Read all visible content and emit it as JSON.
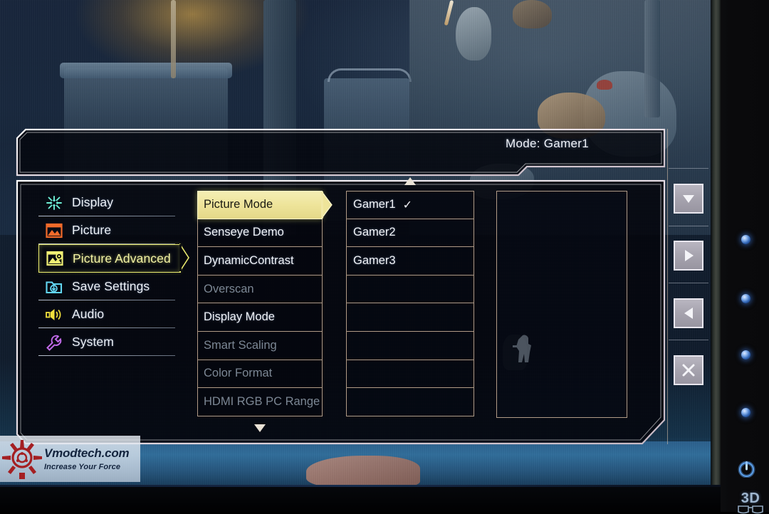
{
  "osd": {
    "title": "Mode: Gamer1",
    "sidebar": [
      {
        "label": "Display",
        "icon": "display-icon",
        "active": false
      },
      {
        "label": "Picture",
        "icon": "picture-icon",
        "active": false
      },
      {
        "label": "Picture Advanced",
        "icon": "picture-advanced-icon",
        "active": true
      },
      {
        "label": "Save Settings",
        "icon": "save-settings-icon",
        "active": false
      },
      {
        "label": "Audio",
        "icon": "audio-icon",
        "active": false
      },
      {
        "label": "System",
        "icon": "system-icon",
        "active": false
      }
    ],
    "settings_column": [
      {
        "label": "Picture Mode",
        "state": "selected"
      },
      {
        "label": "Senseye Demo",
        "state": "normal"
      },
      {
        "label": "DynamicContrast",
        "state": "normal"
      },
      {
        "label": "Overscan",
        "state": "disabled"
      },
      {
        "label": "Display Mode",
        "state": "normal"
      },
      {
        "label": "Smart Scaling",
        "state": "disabled"
      },
      {
        "label": "Color Format",
        "state": "disabled"
      },
      {
        "label": "HDMI RGB PC Range",
        "state": "disabled"
      }
    ],
    "values_column": [
      {
        "label": "Gamer1",
        "checked": true
      },
      {
        "label": "Gamer2",
        "checked": false
      },
      {
        "label": "Gamer3",
        "checked": false
      },
      {
        "label": "",
        "checked": false
      },
      {
        "label": "",
        "checked": false
      },
      {
        "label": "",
        "checked": false
      },
      {
        "label": "",
        "checked": false
      },
      {
        "label": "",
        "checked": false
      }
    ],
    "scroll": {
      "up": "▲",
      "down": "▼"
    },
    "check_glyph": "✓",
    "buttons": [
      {
        "name": "down-button",
        "glyph": "▼"
      },
      {
        "name": "right-button",
        "glyph": "▶"
      },
      {
        "name": "left-button",
        "glyph": "◀"
      },
      {
        "name": "exit-button",
        "glyph": "✕"
      }
    ],
    "colors": {
      "highlight": "#eee49a",
      "active_border": "#e9ea6e",
      "panel_border": "#e2c4a8",
      "text": "#eef2f8",
      "text_disabled": "#7c8794"
    }
  },
  "watermark": {
    "title": "Vmodtech.com",
    "subtitle": "Increase Your Force"
  },
  "monitor": {
    "badge_3d": "3D",
    "led_count": 4,
    "power_label": "power"
  }
}
